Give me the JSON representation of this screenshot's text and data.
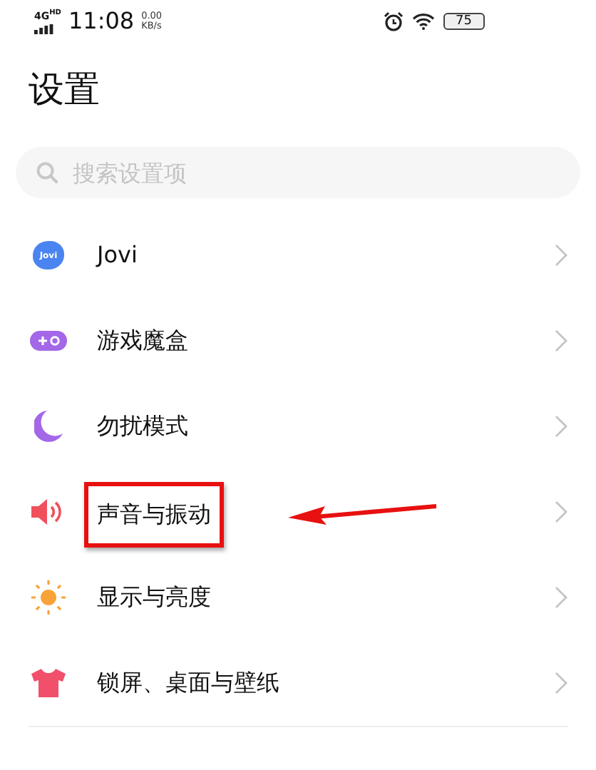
{
  "status_bar": {
    "network": "4G",
    "network_badge": "HD",
    "time": "11:08",
    "speed": "0.00",
    "speed_unit": "KB/s",
    "battery": "75"
  },
  "title": "设置",
  "search": {
    "placeholder": "搜索设置项"
  },
  "items": [
    {
      "label": "Jovi",
      "kind": "jovi",
      "icon_text": "Jovi",
      "annotated": false
    },
    {
      "label": "游戏魔盒",
      "kind": "game",
      "annotated": false
    },
    {
      "label": "勿扰模式",
      "kind": "moon",
      "annotated": false
    },
    {
      "label": "声音与振动",
      "kind": "speaker",
      "annotated": true
    },
    {
      "label": "显示与亮度",
      "kind": "sun",
      "annotated": false
    },
    {
      "label": "锁屏、桌面与壁纸",
      "kind": "shirt",
      "annotated": false
    }
  ]
}
